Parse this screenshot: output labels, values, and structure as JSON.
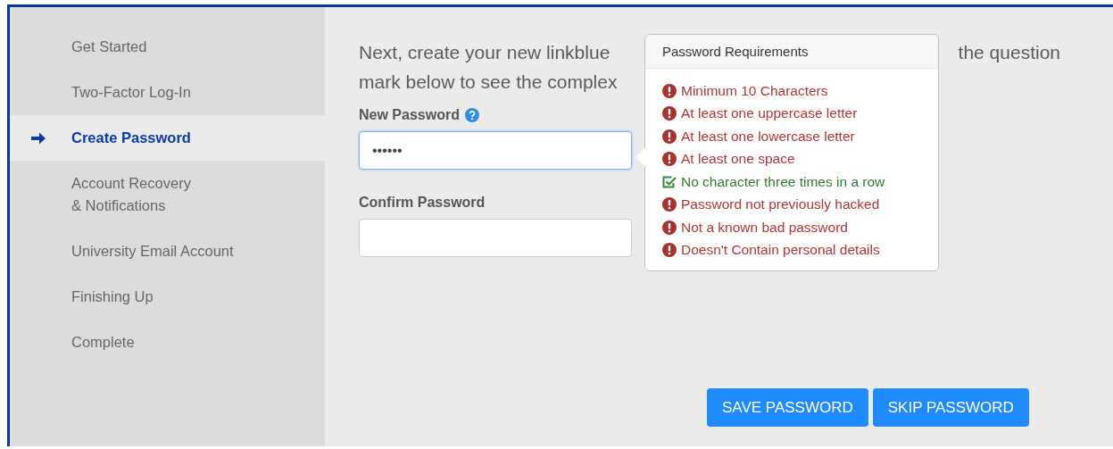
{
  "sidebar": {
    "items": [
      {
        "label": "Get Started",
        "selected": false
      },
      {
        "label": "Two-Factor Log-In",
        "selected": false
      },
      {
        "label": "Create Password",
        "selected": true
      },
      {
        "label": "Account Recovery\n& Notifications",
        "selected": false
      },
      {
        "label": "University Email Account",
        "selected": false
      },
      {
        "label": "Finishing Up",
        "selected": false
      },
      {
        "label": "Complete",
        "selected": false
      }
    ]
  },
  "intro": {
    "line_1_start": "Next, create your new linkblue",
    "line_1_end": "the question",
    "line_2_start": "mark below to see the complex"
  },
  "new_password": {
    "label": "New Password",
    "value": "••••••",
    "focused": true
  },
  "confirm_password": {
    "label": "Confirm Password"
  },
  "requirements": {
    "title": "Password Requirements",
    "items": [
      {
        "text": "Minimum 10 Characters",
        "met": false
      },
      {
        "text": "At least one uppercase letter",
        "met": false
      },
      {
        "text": "At least one lowercase letter",
        "met": false
      },
      {
        "text": "At least one space",
        "met": false
      },
      {
        "text": "No character three times in a row",
        "met": true
      },
      {
        "text": "Password not previously hacked",
        "met": false
      },
      {
        "text": "Not a known bad password",
        "met": false
      },
      {
        "text": "Doesn't Contain personal details",
        "met": false
      }
    ]
  },
  "buttons": [
    "SAVE PASSWORD",
    "SKIP PASSWORD"
  ]
}
